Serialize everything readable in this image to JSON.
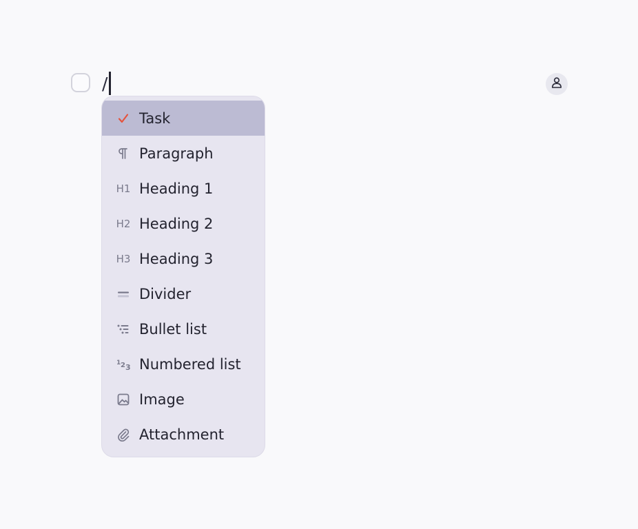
{
  "editor": {
    "text": "/"
  },
  "menu": {
    "items": [
      {
        "label": "Task",
        "icon": "check-icon"
      },
      {
        "label": "Paragraph",
        "icon": "pilcrow-icon"
      },
      {
        "label": "Heading 1",
        "icon": "heading-1-icon",
        "glyph": "H1"
      },
      {
        "label": "Heading 2",
        "icon": "heading-2-icon",
        "glyph": "H2"
      },
      {
        "label": "Heading 3",
        "icon": "heading-3-icon",
        "glyph": "H3"
      },
      {
        "label": "Divider",
        "icon": "divider-icon"
      },
      {
        "label": "Bullet list",
        "icon": "bullet-list-icon"
      },
      {
        "label": "Numbered list",
        "icon": "numbered-list-icon",
        "glyph": "123"
      },
      {
        "label": "Image",
        "icon": "image-icon"
      },
      {
        "label": "Attachment",
        "icon": "paperclip-icon"
      }
    ],
    "selected": "Task"
  },
  "colors": {
    "accent_check": "#e5533d",
    "selected_bg": "#bcbbd3",
    "menu_bg": "#e7e5f0",
    "page_bg": "#f9f9fb"
  }
}
